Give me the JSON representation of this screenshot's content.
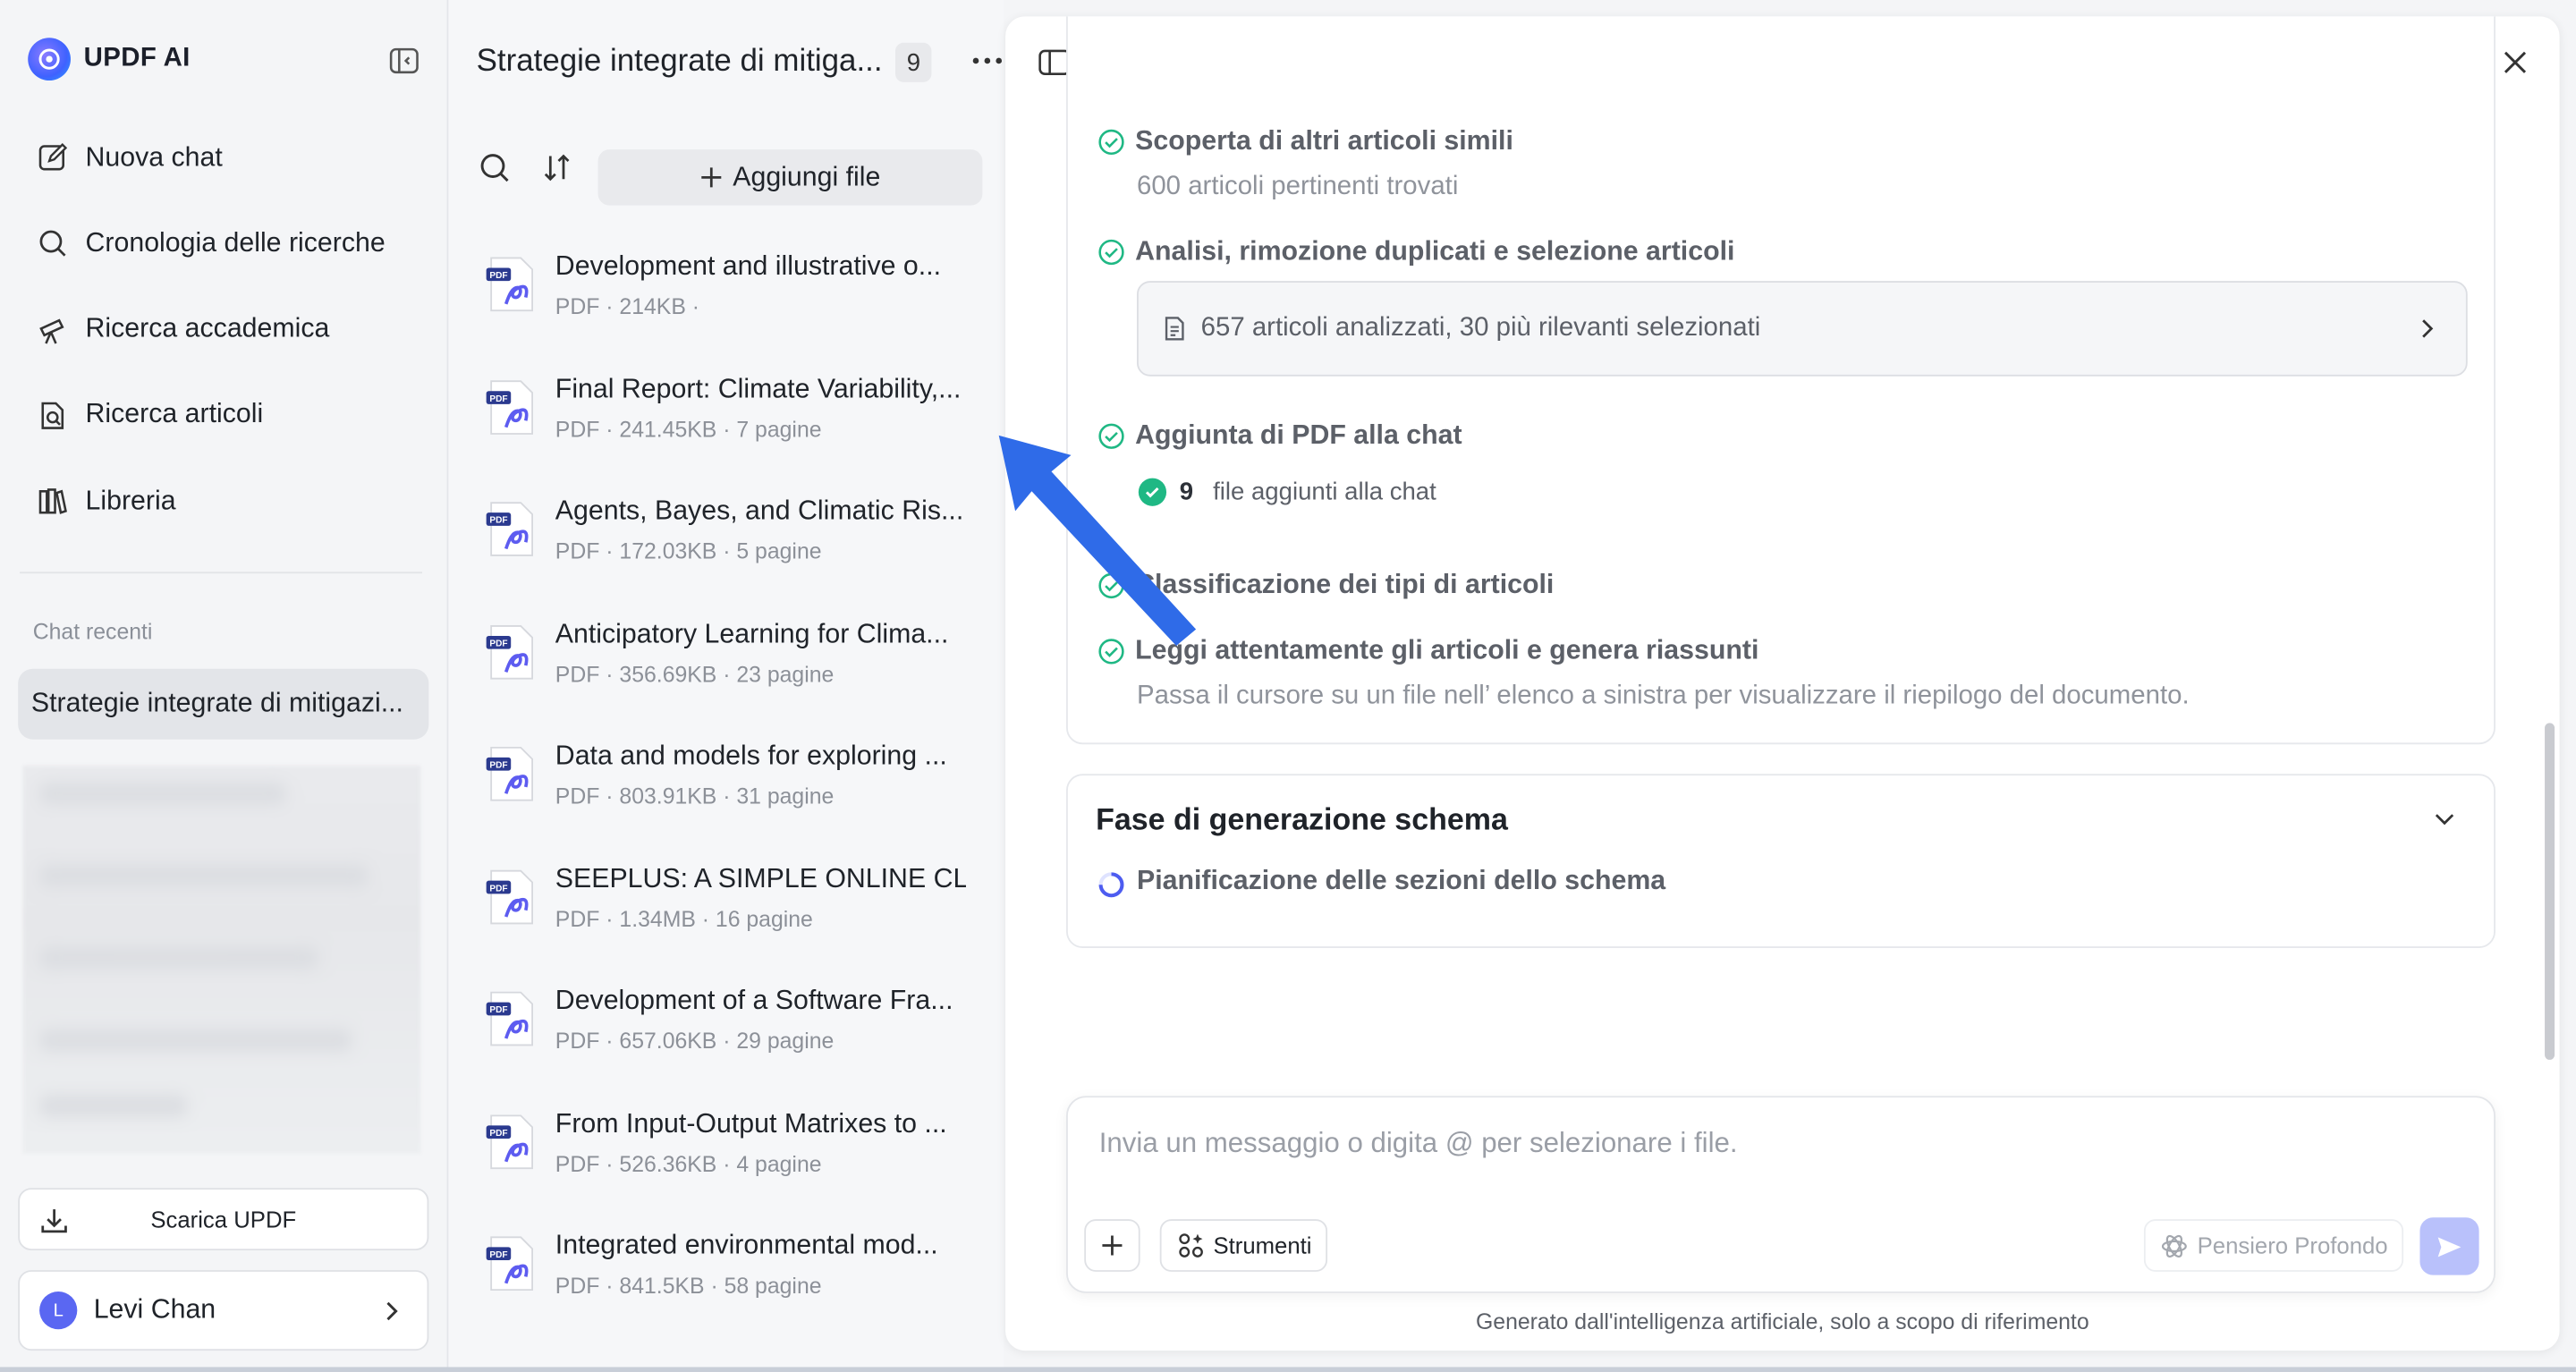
{
  "brand": {
    "name": "UPDF AI"
  },
  "nav": [
    {
      "label": "Nuova chat",
      "icon": "edit-icon"
    },
    {
      "label": "Cronologia delle ricerche",
      "icon": "search-icon"
    },
    {
      "label": "Ricerca accademica",
      "icon": "telescope-icon"
    },
    {
      "label": "Ricerca articoli",
      "icon": "file-search-icon"
    },
    {
      "label": "Libreria",
      "icon": "library-icon"
    }
  ],
  "recent": {
    "heading": "Chat recenti",
    "items": [
      {
        "label": "Strategie integrate di mitigazi..."
      }
    ]
  },
  "download": {
    "label": "Scarica UPDF"
  },
  "user": {
    "name": "Levi Chan",
    "initial": "L"
  },
  "files": {
    "title": "Strategie integrate di mitiga...",
    "count": "9",
    "add_label": "Aggiungi file",
    "items": [
      {
        "name": "Development and illustrative o...",
        "meta": "PDF · 214KB ·"
      },
      {
        "name": "Final Report: Climate Variability,...",
        "meta": "PDF · 241.45KB · 7 pagine"
      },
      {
        "name": "Agents, Bayes, and Climatic Ris...",
        "meta": "PDF · 172.03KB · 5 pagine"
      },
      {
        "name": "Anticipatory Learning for Clima...",
        "meta": "PDF · 356.69KB · 23 pagine"
      },
      {
        "name": "Data and models for exploring ...",
        "meta": "PDF · 803.91KB · 31 pagine"
      },
      {
        "name": "SEEPLUS: A SIMPLE ONLINE CLI...",
        "meta": "PDF · 1.34MB · 16 pagine"
      },
      {
        "name": "Development of a Software Fra...",
        "meta": "PDF · 657.06KB · 29 pagine"
      },
      {
        "name": "From Input-Output Matrixes to ...",
        "meta": "PDF · 526.36KB · 4 pagine"
      },
      {
        "name": "Integrated environmental mod...",
        "meta": "PDF · 841.5KB · 58 pagine"
      }
    ]
  },
  "progress": {
    "steps": [
      {
        "label": "Scoperta di altri articoli simili",
        "sub": "600 articoli pertinenti trovati"
      },
      {
        "label": "Analisi, rimozione duplicati e selezione articoli",
        "result": "657 articoli analizzati, 30 più rilevanti selezionati"
      },
      {
        "label": "Aggiunta di PDF alla chat",
        "added_count": "9",
        "added_text": "file aggiunti alla chat"
      },
      {
        "label": "Classificazione dei tipi di articoli"
      },
      {
        "label": "Leggi attentamente gli articoli e genera riassunti",
        "sub": "Passa il cursore su un file nell’ elenco a sinistra per visualizzare il riepilogo del documento."
      }
    ]
  },
  "outline": {
    "title": "Fase di generazione schema",
    "step": "Pianificazione delle sezioni dello schema"
  },
  "composer": {
    "placeholder": "Invia un messaggio o digita @ per selezionare i file.",
    "tools_label": "Strumenti",
    "deep_label": "Pensiero Profondo"
  },
  "disclaimer": "Generato dall'intelligenza artificiale, solo a scopo di riferimento",
  "colors": {
    "accent": "#3f62ff",
    "success": "#1fb884",
    "send_disabled": "#b9c1fb",
    "arrow": "#2f6be8"
  }
}
